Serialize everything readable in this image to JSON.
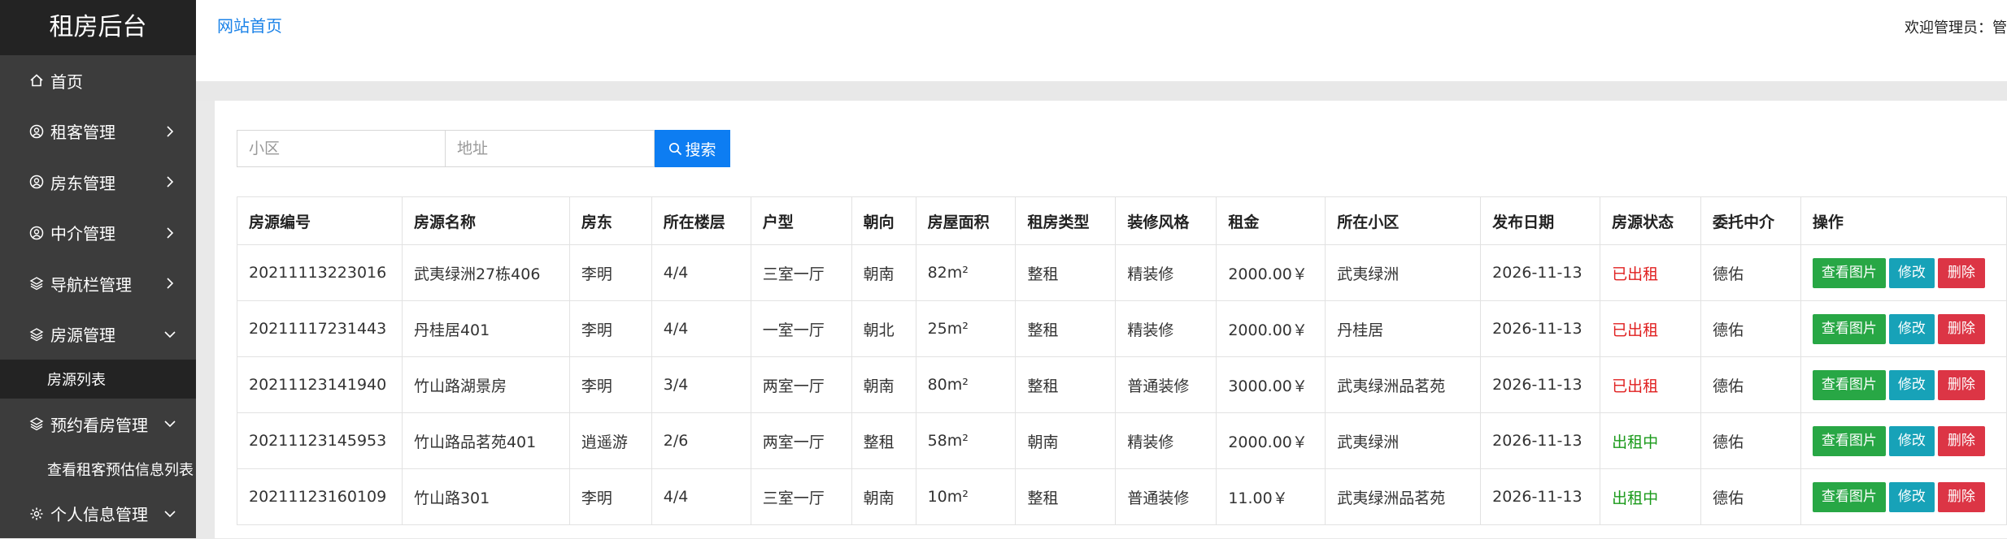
{
  "brand": "租房后台",
  "sidebar": {
    "items": [
      {
        "label": "首页",
        "icon": "home-icon",
        "chevron": ""
      },
      {
        "label": "租客管理",
        "icon": "user-circle-icon",
        "chevron": "right"
      },
      {
        "label": "房东管理",
        "icon": "user-circle-icon",
        "chevron": "right"
      },
      {
        "label": "中介管理",
        "icon": "user-circle-icon",
        "chevron": "right"
      },
      {
        "label": "导航栏管理",
        "icon": "layers-icon",
        "chevron": "right"
      },
      {
        "label": "房源管理",
        "icon": "layers-icon",
        "chevron": "down"
      },
      {
        "label": "房源列表",
        "sub": true,
        "active": true
      },
      {
        "label": "预约看房管理",
        "icon": "layers-icon",
        "chevron": "down"
      },
      {
        "label": "查看租客预估信息列表",
        "sub": true
      },
      {
        "label": "个人信息管理",
        "icon": "gear-icon",
        "chevron": "down"
      }
    ]
  },
  "header": {
    "home_link": "网站首页",
    "welcome": "欢迎管理员：管"
  },
  "search": {
    "community_placeholder": "小区",
    "address_placeholder": "地址",
    "button_label": "搜索"
  },
  "table": {
    "headers": [
      "房源编号",
      "房源名称",
      "房东",
      "所在楼层",
      "户型",
      "朝向",
      "房屋面积",
      "租房类型",
      "装修风格",
      "租金",
      "所在小区",
      "发布日期",
      "房源状态",
      "委托中介",
      "操作"
    ],
    "rows": [
      [
        "20211113223016",
        "武夷绿洲27栋406",
        "李明",
        "4/4",
        "三室一厅",
        "朝南",
        "82m²",
        "整租",
        "精装修",
        "2000.00￥",
        "武夷绿洲",
        "2026-11-13",
        "已出租",
        "德佑"
      ],
      [
        "20211117231443",
        "丹桂居401",
        "李明",
        "4/4",
        "一室一厅",
        "朝北",
        "25m²",
        "整租",
        "精装修",
        "2000.00￥",
        "丹桂居",
        "2026-11-13",
        "已出租",
        "德佑"
      ],
      [
        "20211123141940",
        "竹山路湖景房",
        "李明",
        "3/4",
        "两室一厅",
        "朝南",
        "80m²",
        "整租",
        "普通装修",
        "3000.00￥",
        "武夷绿洲品茗苑",
        "2026-11-13",
        "已出租",
        "德佑"
      ],
      [
        "20211123145953",
        "竹山路品茗苑401",
        "逍遥游",
        "2/6",
        "两室一厅",
        "整租",
        "58m²",
        "朝南",
        "精装修",
        "2000.00￥",
        "武夷绿洲",
        "2026-11-13",
        "出租中",
        "德佑"
      ],
      [
        "20211123160109",
        "竹山路301",
        "李明",
        "4/4",
        "三室一厅",
        "朝南",
        "10m²",
        "整租",
        "普通装修",
        "11.00￥",
        "武夷绿洲品茗苑",
        "2026-11-13",
        "出租中",
        "德佑"
      ]
    ],
    "status_colors": {
      "已出租": "#e02020",
      "出租中": "#1a9a1a"
    },
    "actions": {
      "view_images": "查看图片",
      "edit": "修改",
      "delete": "删除"
    }
  }
}
